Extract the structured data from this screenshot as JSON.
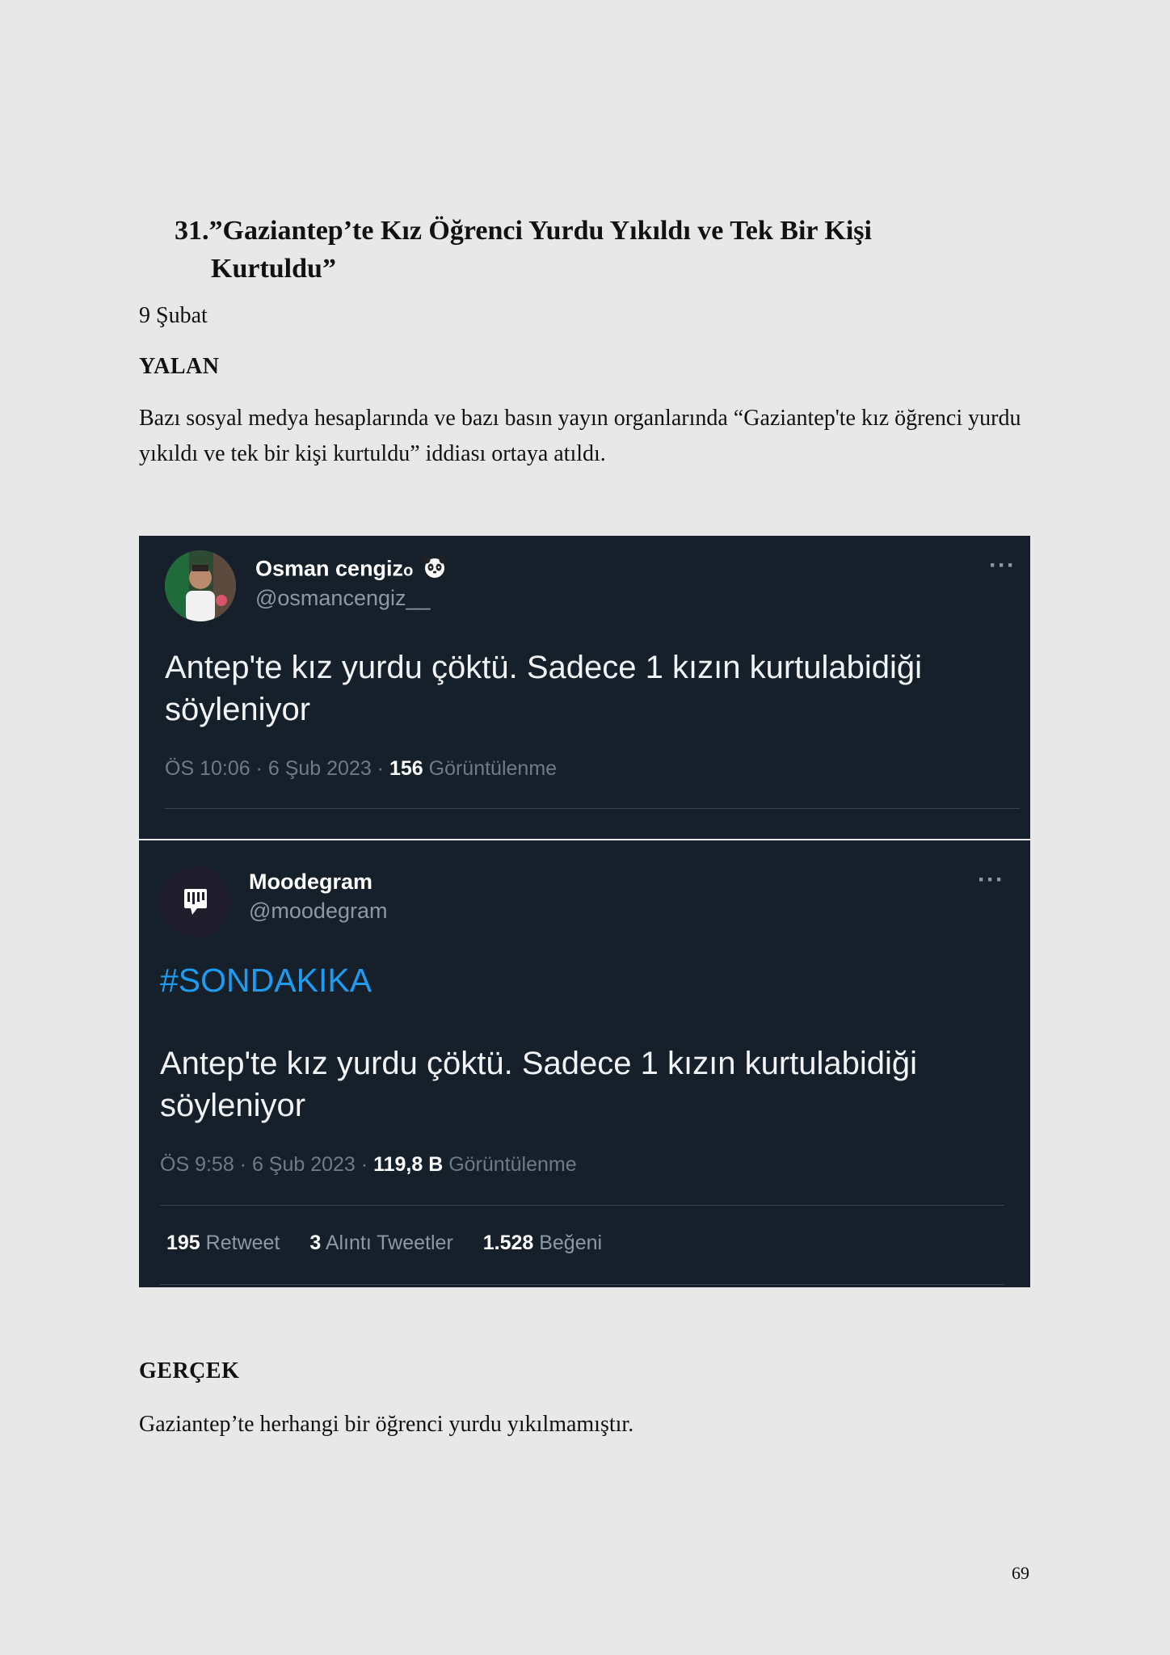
{
  "heading": {
    "line1": "31.”Gaziantep’te Kız Öğrenci Yurdu Yıkıldı ve Tek Bir Kişi",
    "line2": "Kurtuldu”"
  },
  "date": "9 Şubat",
  "claim_label": "YALAN",
  "claim_text": "Bazı sosyal medya hesaplarında ve bazı basın yayın organlarında “Gaziantep'te kız öğrenci yurdu yıkıldı ve tek bir kişi kurtuldu” iddiası ortaya atıldı.",
  "tweet1": {
    "name": "Osman cengiz",
    "name_suffix": "o",
    "badge_icon": "panda-emoji-icon",
    "handle": "@osmancengiz__",
    "more": "···",
    "text": "Antep'te kız yurdu çöktü. Sadece 1 kızın kurtulabidiği söyleniyor",
    "time": "ÖS 10:06 · 6 Şub 2023 · ",
    "views_count": "156",
    "views_label": " Görüntülenme"
  },
  "tweet2": {
    "name": "Moodegram",
    "handle": "@moodegram",
    "more": "···",
    "hashtag": "#SONDAKIKA",
    "text": "Antep'te kız yurdu çöktü. Sadece 1 kızın kurtulabidiği söyleniyor",
    "time": "ÖS 9:58 · 6 Şub 2023 · ",
    "views_count": "119,8 B",
    "views_label": " Görüntülenme",
    "retweet_count": "195",
    "retweet_label": " Retweet",
    "quote_count": "3",
    "quote_label": " Alıntı Tweetler",
    "like_count": "1.528",
    "like_label": " Beğeni"
  },
  "fact_label": "GERÇEK",
  "fact_text": "Gaziantep’te herhangi bir öğrenci yurdu yıkılmamıştır.",
  "page_number": "69",
  "colors": {
    "page_bg": "#e8e8e8",
    "tweet_bg": "#15202b",
    "hashtag_blue": "#1d9bf0",
    "muted_gray": "#8b98a5"
  }
}
